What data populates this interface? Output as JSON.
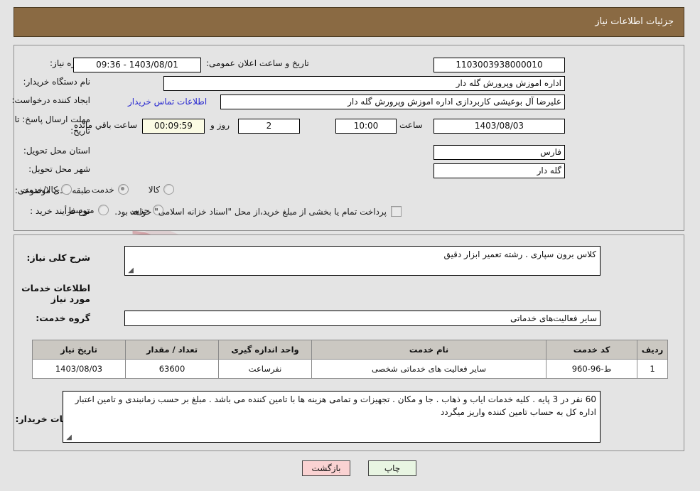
{
  "header": {
    "title": "جزئیات اطلاعات نیاز"
  },
  "fields": {
    "need_number_label": "شماره نیاز:",
    "need_number_value": "1103003938000010",
    "announce_label": "تاریخ و ساعت اعلان عمومی:",
    "announce_value": "1403/08/01 - 09:36",
    "buyer_org_label": "نام دستگاه خریدار:",
    "buyer_org_value": "اداره اموزش وپرورش گله دار",
    "creator_label": "ایجاد کننده درخواست:",
    "creator_value": "علیرضا آل بوعیشی کاربردازی اداره اموزش وپرورش گله دار",
    "contact_link": "اطلاعات تماس خریدار",
    "deadline_label": "مهلت ارسال پاسخ: تا تاریخ:",
    "deadline_date": "1403/08/03",
    "hour_label": "ساعت",
    "deadline_time": "10:00",
    "days_value": "2",
    "days_label": "روز و",
    "countdown_value": "00:09:59",
    "countdown_label": "ساعت باقي مانده",
    "province_label": "استان محل تحویل:",
    "province_value": "فارس",
    "city_label": "شهر محل تحویل:",
    "city_value": "گله دار",
    "category_label": "طبقه بندی موضوعی:",
    "process_label": "نوع فرأیند خرید :",
    "treasury_note": "پرداخت تمام یا بخشی از مبلغ خرید،از محل \"اسناد خزانه اسلامی\" خواهد بود."
  },
  "category_options": [
    {
      "label": "کالا",
      "selected": false
    },
    {
      "label": "خدمت",
      "selected": true
    },
    {
      "label": "کالا/خدمت",
      "selected": false
    }
  ],
  "process_options": [
    {
      "label": "جزیی",
      "selected": false
    },
    {
      "label": "متوسط",
      "selected": false
    }
  ],
  "treasury_checkbox_checked": false,
  "description": {
    "label": "شرح کلی نیاز:",
    "value": "کلاس برون سپاری . رشته تعمیر ابزار دقیق"
  },
  "services_section": {
    "heading": "اطلاعات خدمات مورد نیاز",
    "group_label": "گروه خدمت:",
    "group_value": "سایر فعالیت‌های خدماتی"
  },
  "table": {
    "columns": [
      "ردیف",
      "کد خدمت",
      "نام خدمت",
      "واحد اندازه گیری",
      "تعداد / مقدار",
      "تاریخ نیاز"
    ],
    "rows": [
      {
        "row_no": "1",
        "service_code": "ط-96-960",
        "service_name": "سایر فعالیت های خدماتی شخصی",
        "unit": "نفرساعت",
        "quantity": "63600",
        "need_date": "1403/08/03"
      }
    ]
  },
  "notes": {
    "label": "توضیحات خریدار:",
    "value": "60 نفر در 3 پایه . کلیه خدمات ایاب و ذهاب . جا و مکان . تجهیزات و تمامی هزینه ها با تامین کننده می باشد . مبلغ بر حسب زمانبندی و تامین اعتبار اداره کل  به حساب تامین کننده واریز میگردد"
  },
  "buttons": {
    "print": "چاپ",
    "back": "بازگشت"
  },
  "watermark": {
    "text": "AriaTender.net"
  },
  "colors": {
    "header_bg": "#8a6a43",
    "page_bg": "#e4e4e4",
    "link": "#2a2ad0",
    "print_btn": "#e8f5e2",
    "back_btn": "#fad2d2",
    "countdown_bg": "#fbfbe4"
  }
}
